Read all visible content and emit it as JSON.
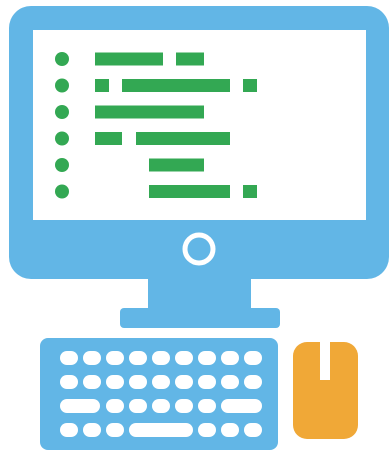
{
  "illustration": {
    "icon_name": "desktop-computer-with-code-icon",
    "colors": {
      "monitor": "#62b6e6",
      "screen": "#ffffff",
      "code": "#33a853",
      "keys": "#ffffff",
      "mouse": "#f0a837"
    },
    "code_lines": [
      {
        "dot": true,
        "segments": [
          [
            95,
            163
          ],
          [
            176,
            204
          ]
        ]
      },
      {
        "dot": true,
        "segments": [
          [
            95,
            109
          ],
          [
            122,
            230
          ],
          [
            243,
            257
          ]
        ]
      },
      {
        "dot": true,
        "segments": [
          [
            95,
            204
          ]
        ]
      },
      {
        "dot": true,
        "segments": [
          [
            95,
            122
          ],
          [
            136,
            230
          ]
        ]
      },
      {
        "dot": true,
        "segments": [
          [
            149,
            204
          ]
        ]
      },
      {
        "dot": true,
        "segments": [
          [
            149,
            230
          ],
          [
            243,
            257
          ]
        ]
      }
    ]
  }
}
